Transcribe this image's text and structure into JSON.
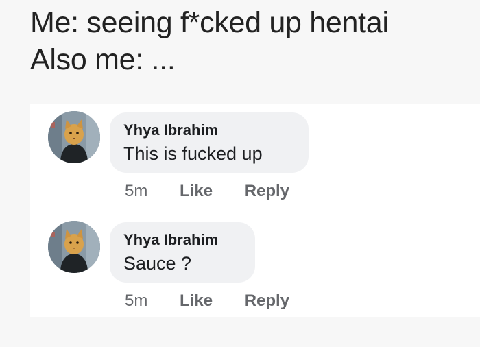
{
  "caption": {
    "line1": "Me: seeing f*cked up hentai",
    "line2": "Also me: ..."
  },
  "comments": [
    {
      "author": "Yhya Ibrahim",
      "text": "This is fucked up",
      "time": "5m",
      "like_label": "Like",
      "reply_label": "Reply",
      "avatar": "cat-avatar-icon"
    },
    {
      "author": "Yhya Ibrahim",
      "text": "Sauce ?",
      "time": "5m",
      "like_label": "Like",
      "reply_label": "Reply",
      "avatar": "cat-avatar-icon"
    }
  ],
  "colors": {
    "bubble": "#f0f1f3",
    "text": "#1c1e21",
    "meta": "#65676b"
  }
}
